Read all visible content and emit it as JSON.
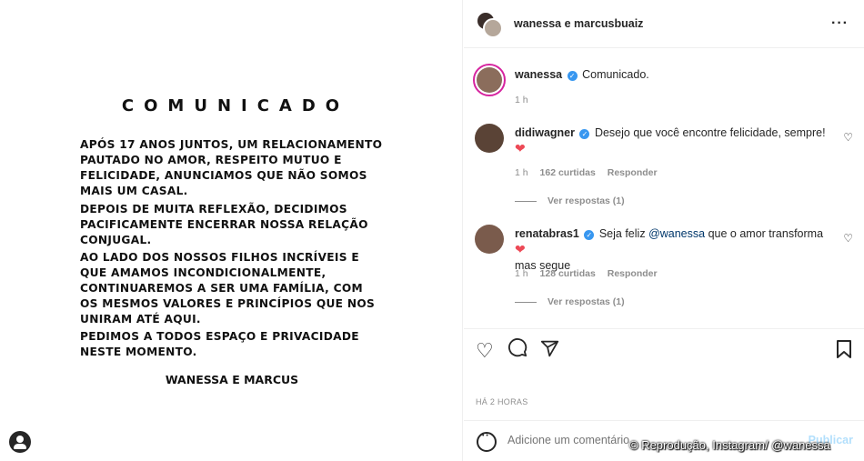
{
  "post": {
    "title": "COMUNICADO",
    "paragraphs": [
      "APÓS 17 ANOS JUNTOS, UM RELACIONAMENTO PAUTADO NO AMOR, RESPEITO MUTUO E FELICIDADE, ANUNCIAMOS QUE NÃO SOMOS MAIS UM CASAL.",
      "DEPOIS DE MUITA REFLEXÃO, DECIDIMOS PACIFICAMENTE ENCERRAR NOSSA RELAÇÃO CONJUGAL.",
      "AO LADO DOS NOSSOS FILHOS INCRÍVEIS E QUE AMAMOS INCONDICIONALMENTE, CONTINUAREMOS A SER UMA FAMÍLIA, COM OS MESMOS VALORES E PRINCÍPIOS QUE NOS UNIRAM ATÉ AQUI.",
      "PEDIMOS A TODOS ESPAÇO E PRIVACIDADE NESTE MOMENTO."
    ],
    "signature": "WANESSA E MARCUS"
  },
  "header": {
    "names": "wanessa e marcusbuaiz",
    "more_icon": "more-horizontal-icon"
  },
  "caption": {
    "user": "wanessa",
    "text": "Comunicado.",
    "time": "1 h"
  },
  "comments": [
    {
      "user": "didiwagner",
      "text": "Desejo que você encontre felicidade, sempre!",
      "emoji": "❤",
      "time": "1 h",
      "likes": "162 curtidas",
      "reply": "Responder",
      "view_replies": "Ver respostas (1)"
    },
    {
      "user": "renatabras1",
      "text_before": "Seja feliz",
      "mention": "@wanessa",
      "text_after": "que o amor transforma",
      "emoji": "❤",
      "text_end": "mas segue",
      "time": "1 h",
      "likes": "128 curtidas",
      "reply": "Responder",
      "view_replies": "Ver respostas (1)"
    }
  ],
  "actions": {
    "time_ago": "HÁ 2 HORAS"
  },
  "add_comment": {
    "placeholder": "Adicione um comentário...",
    "publish": "Publicar"
  },
  "credit": "© Reprodução, Instagram/ @wanessa",
  "colors": {
    "verified": "#3897f0",
    "heart": "#ed4956",
    "publish": "#b2dffc"
  }
}
